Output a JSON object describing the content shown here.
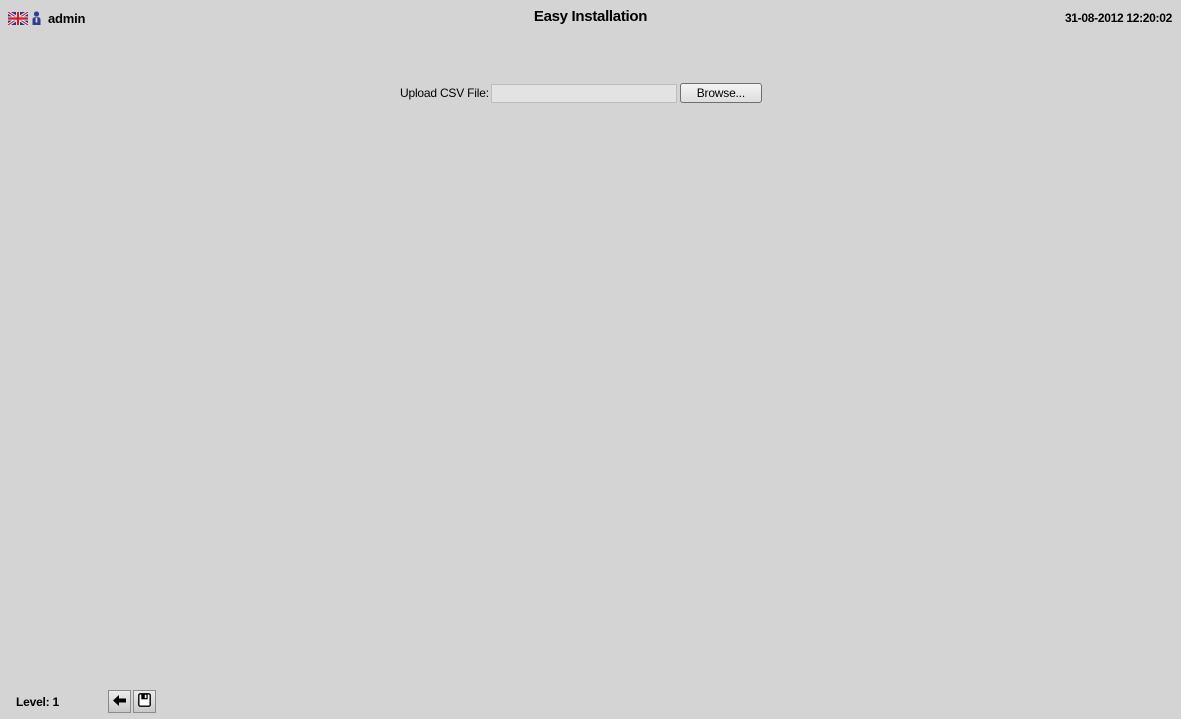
{
  "header": {
    "language_icon": "uk-flag-icon",
    "user_icon": "user-icon",
    "username": "admin",
    "title": "Easy Installation",
    "datetime": "31-08-2012 12:20:02"
  },
  "upload": {
    "label": "Upload CSV File:",
    "value": "",
    "browse_label": "Browse..."
  },
  "footer": {
    "level_label": "Level:",
    "level_value": "1",
    "tools": [
      {
        "icon": "back-arrow-icon"
      },
      {
        "icon": "save-disk-icon"
      }
    ]
  },
  "colors": {
    "background": "#d4d4d4",
    "flag_blue": "#1f3a93",
    "flag_red": "#cc1f2c"
  }
}
